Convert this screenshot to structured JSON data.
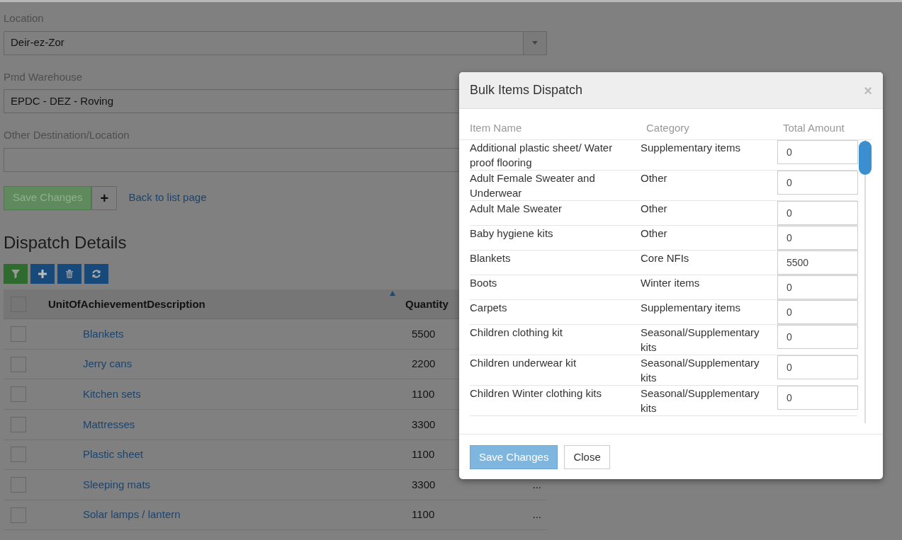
{
  "form": {
    "fields": [
      {
        "label": "Location",
        "value": "Deir-ez-Zor",
        "kind": "select"
      },
      {
        "label": "Pmd Warehouse",
        "value": "EPDC - DEZ - Roving",
        "kind": "text"
      },
      {
        "label": "Other Destination/Location",
        "kind": "text"
      }
    ],
    "save_button": "Save Changes",
    "add_button": "+",
    "back_link": "Back to list page"
  },
  "dispatch_details": {
    "title": "Dispatch Details",
    "toolbar": [
      {
        "kind": "filter"
      },
      {
        "kind": "add"
      },
      {
        "kind": "delete"
      },
      {
        "kind": "refresh"
      }
    ],
    "select_all_checked": false,
    "columns": [
      {
        "label": "UnitOfAchievementDescription",
        "sorted": true
      },
      {
        "label": "Quantity",
        "sorted": false
      }
    ],
    "rows": [
      {
        "description": "Blankets",
        "quantity": "5500",
        "checked": false
      },
      {
        "description": "Jerry cans",
        "quantity": "2200",
        "checked": false
      },
      {
        "description": "Kitchen sets",
        "quantity": "1100",
        "checked": false
      },
      {
        "description": "Mattresses",
        "quantity": "3300",
        "checked": false
      },
      {
        "description": "Plastic sheet",
        "quantity": "1100",
        "checked": false
      },
      {
        "description": "Sleeping mats",
        "quantity": "3300",
        "checked": false,
        "menu": "..."
      },
      {
        "description": "Solar lamps / lantern",
        "quantity": "1100",
        "checked": false,
        "menu": "..."
      }
    ]
  },
  "modal": {
    "title": "Bulk Items Dispatch",
    "close": "×",
    "columns": [
      "Item Name",
      "Category",
      "Total Amount"
    ],
    "items": [
      {
        "name": "Additional plastic sheet/ Water proof flooring",
        "category": "Supplementary items",
        "amount": "0"
      },
      {
        "name": "Adult Female Sweater and Underwear",
        "category": "Other",
        "amount": "0"
      },
      {
        "name": "Adult Male Sweater",
        "category": "Other",
        "amount": "0"
      },
      {
        "name": "Baby hygiene kits",
        "category": "Other",
        "amount": "0"
      },
      {
        "name": "Blankets",
        "category": "Core NFIs",
        "amount": "5500"
      },
      {
        "name": "Boots",
        "category": "Winter items",
        "amount": "0"
      },
      {
        "name": "Carpets",
        "category": "Supplementary items",
        "amount": "0"
      },
      {
        "name": "Children clothing kit",
        "category": "Seasonal/Supplementary kits",
        "amount": "0"
      },
      {
        "name": "Children underwear kit",
        "category": "Seasonal/Supplementary kits",
        "amount": "0"
      },
      {
        "name": "Children Winter clothing kits",
        "category": "Seasonal/Supplementary kits",
        "amount": "0"
      }
    ],
    "buttons": [
      {
        "label": "Save Changes",
        "kind": "primary"
      },
      {
        "label": "Close",
        "kind": "secondary"
      }
    ]
  }
}
